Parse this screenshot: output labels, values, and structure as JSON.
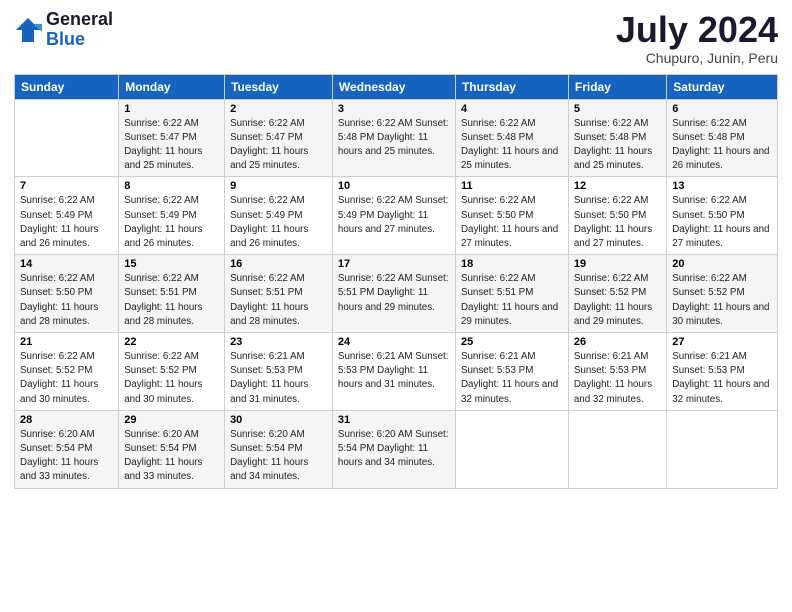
{
  "logo": {
    "general": "General",
    "blue": "Blue"
  },
  "title": "July 2024",
  "subtitle": "Chupuro, Junin, Peru",
  "headers": [
    "Sunday",
    "Monday",
    "Tuesday",
    "Wednesday",
    "Thursday",
    "Friday",
    "Saturday"
  ],
  "weeks": [
    [
      {
        "day": "",
        "info": ""
      },
      {
        "day": "1",
        "info": "Sunrise: 6:22 AM\nSunset: 5:47 PM\nDaylight: 11 hours\nand 25 minutes."
      },
      {
        "day": "2",
        "info": "Sunrise: 6:22 AM\nSunset: 5:47 PM\nDaylight: 11 hours\nand 25 minutes."
      },
      {
        "day": "3",
        "info": "Sunrise: 6:22 AM\nSunset: 5:48 PM\nDaylight: 11 hours\nand 25 minutes."
      },
      {
        "day": "4",
        "info": "Sunrise: 6:22 AM\nSunset: 5:48 PM\nDaylight: 11 hours\nand 25 minutes."
      },
      {
        "day": "5",
        "info": "Sunrise: 6:22 AM\nSunset: 5:48 PM\nDaylight: 11 hours\nand 25 minutes."
      },
      {
        "day": "6",
        "info": "Sunrise: 6:22 AM\nSunset: 5:48 PM\nDaylight: 11 hours\nand 26 minutes."
      }
    ],
    [
      {
        "day": "7",
        "info": "Sunrise: 6:22 AM\nSunset: 5:49 PM\nDaylight: 11 hours\nand 26 minutes."
      },
      {
        "day": "8",
        "info": "Sunrise: 6:22 AM\nSunset: 5:49 PM\nDaylight: 11 hours\nand 26 minutes."
      },
      {
        "day": "9",
        "info": "Sunrise: 6:22 AM\nSunset: 5:49 PM\nDaylight: 11 hours\nand 26 minutes."
      },
      {
        "day": "10",
        "info": "Sunrise: 6:22 AM\nSunset: 5:49 PM\nDaylight: 11 hours\nand 27 minutes."
      },
      {
        "day": "11",
        "info": "Sunrise: 6:22 AM\nSunset: 5:50 PM\nDaylight: 11 hours\nand 27 minutes."
      },
      {
        "day": "12",
        "info": "Sunrise: 6:22 AM\nSunset: 5:50 PM\nDaylight: 11 hours\nand 27 minutes."
      },
      {
        "day": "13",
        "info": "Sunrise: 6:22 AM\nSunset: 5:50 PM\nDaylight: 11 hours\nand 27 minutes."
      }
    ],
    [
      {
        "day": "14",
        "info": "Sunrise: 6:22 AM\nSunset: 5:50 PM\nDaylight: 11 hours\nand 28 minutes."
      },
      {
        "day": "15",
        "info": "Sunrise: 6:22 AM\nSunset: 5:51 PM\nDaylight: 11 hours\nand 28 minutes."
      },
      {
        "day": "16",
        "info": "Sunrise: 6:22 AM\nSunset: 5:51 PM\nDaylight: 11 hours\nand 28 minutes."
      },
      {
        "day": "17",
        "info": "Sunrise: 6:22 AM\nSunset: 5:51 PM\nDaylight: 11 hours\nand 29 minutes."
      },
      {
        "day": "18",
        "info": "Sunrise: 6:22 AM\nSunset: 5:51 PM\nDaylight: 11 hours\nand 29 minutes."
      },
      {
        "day": "19",
        "info": "Sunrise: 6:22 AM\nSunset: 5:52 PM\nDaylight: 11 hours\nand 29 minutes."
      },
      {
        "day": "20",
        "info": "Sunrise: 6:22 AM\nSunset: 5:52 PM\nDaylight: 11 hours\nand 30 minutes."
      }
    ],
    [
      {
        "day": "21",
        "info": "Sunrise: 6:22 AM\nSunset: 5:52 PM\nDaylight: 11 hours\nand 30 minutes."
      },
      {
        "day": "22",
        "info": "Sunrise: 6:22 AM\nSunset: 5:52 PM\nDaylight: 11 hours\nand 30 minutes."
      },
      {
        "day": "23",
        "info": "Sunrise: 6:21 AM\nSunset: 5:53 PM\nDaylight: 11 hours\nand 31 minutes."
      },
      {
        "day": "24",
        "info": "Sunrise: 6:21 AM\nSunset: 5:53 PM\nDaylight: 11 hours\nand 31 minutes."
      },
      {
        "day": "25",
        "info": "Sunrise: 6:21 AM\nSunset: 5:53 PM\nDaylight: 11 hours\nand 32 minutes."
      },
      {
        "day": "26",
        "info": "Sunrise: 6:21 AM\nSunset: 5:53 PM\nDaylight: 11 hours\nand 32 minutes."
      },
      {
        "day": "27",
        "info": "Sunrise: 6:21 AM\nSunset: 5:53 PM\nDaylight: 11 hours\nand 32 minutes."
      }
    ],
    [
      {
        "day": "28",
        "info": "Sunrise: 6:20 AM\nSunset: 5:54 PM\nDaylight: 11 hours\nand 33 minutes."
      },
      {
        "day": "29",
        "info": "Sunrise: 6:20 AM\nSunset: 5:54 PM\nDaylight: 11 hours\nand 33 minutes."
      },
      {
        "day": "30",
        "info": "Sunrise: 6:20 AM\nSunset: 5:54 PM\nDaylight: 11 hours\nand 34 minutes."
      },
      {
        "day": "31",
        "info": "Sunrise: 6:20 AM\nSunset: 5:54 PM\nDaylight: 11 hours\nand 34 minutes."
      },
      {
        "day": "",
        "info": ""
      },
      {
        "day": "",
        "info": ""
      },
      {
        "day": "",
        "info": ""
      }
    ]
  ]
}
